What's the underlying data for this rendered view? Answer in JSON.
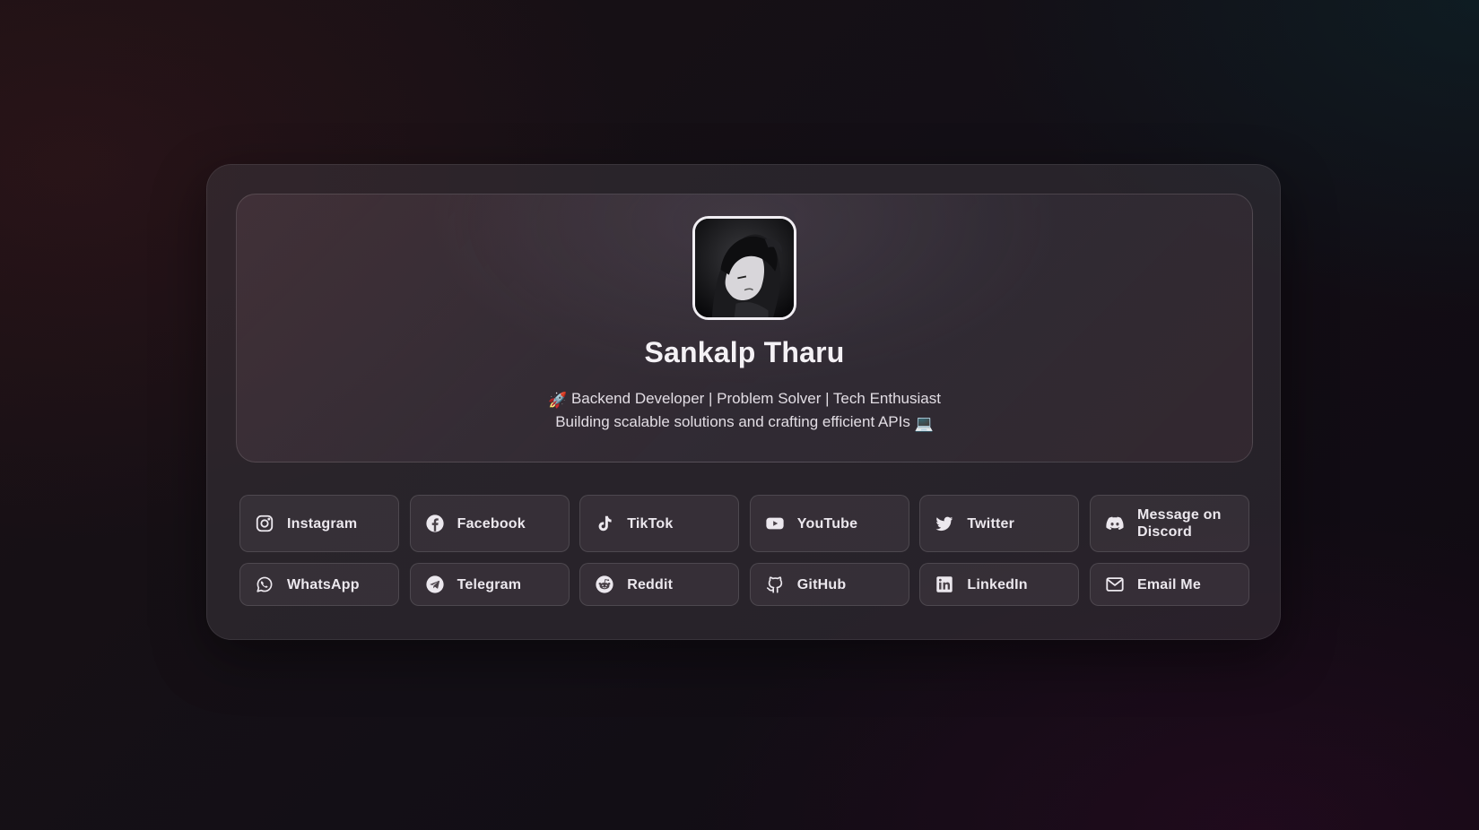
{
  "profile": {
    "name": "Sankalp Tharu",
    "tagline_line1": "Backend Developer | Problem Solver | Tech Enthusiast",
    "tagline_line2": "Building scalable solutions and crafting efficient APIs",
    "emoji_line1": "🚀",
    "emoji_line2": "💻",
    "avatar_icon": "avatar-image"
  },
  "links": [
    {
      "label": "Instagram",
      "icon": "instagram-icon"
    },
    {
      "label": "Facebook",
      "icon": "facebook-icon"
    },
    {
      "label": "TikTok",
      "icon": "tiktok-icon"
    },
    {
      "label": "YouTube",
      "icon": "youtube-icon"
    },
    {
      "label": "Twitter",
      "icon": "twitter-icon"
    },
    {
      "label": "Message on Discord",
      "icon": "discord-icon"
    },
    {
      "label": "WhatsApp",
      "icon": "whatsapp-icon"
    },
    {
      "label": "Telegram",
      "icon": "telegram-icon"
    },
    {
      "label": "Reddit",
      "icon": "reddit-icon"
    },
    {
      "label": "GitHub",
      "icon": "github-icon"
    },
    {
      "label": "LinkedIn",
      "icon": "linkedin-icon"
    },
    {
      "label": "Email Me",
      "icon": "mail-icon"
    }
  ],
  "colors": {
    "background": "#140f14",
    "card": "#3d373f",
    "text": "#ece8ee"
  }
}
